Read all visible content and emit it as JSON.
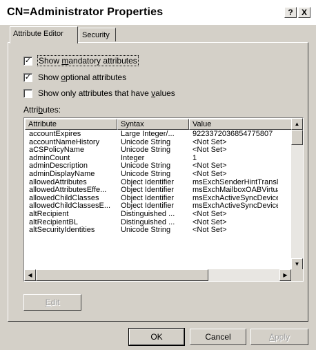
{
  "window": {
    "title": "CN=Administrator Properties",
    "help_glyph": "?",
    "close_glyph": "X"
  },
  "tabs": [
    {
      "label": "Attribute Editor",
      "active": true
    },
    {
      "label": "Security",
      "active": false
    }
  ],
  "checkboxes": [
    {
      "pre": "Show ",
      "accel": "m",
      "post": "andatory attributes",
      "checked": true,
      "check_glyph": "✓"
    },
    {
      "pre": "Show ",
      "accel": "o",
      "post": "ptional attributes",
      "checked": true,
      "check_glyph": "✓"
    },
    {
      "pre": "Show only attributes that have ",
      "accel": "v",
      "post": "alues",
      "checked": false,
      "check_glyph": ""
    }
  ],
  "attributes_label": {
    "pre": "Attri",
    "accel": "b",
    "post": "utes:"
  },
  "table": {
    "columns": [
      "Attribute",
      "Syntax",
      "Value"
    ],
    "rows": [
      [
        "accountExpires",
        "Large Integer/...",
        "9223372036854775807"
      ],
      [
        "accountNameHistory",
        "Unicode String",
        "<Not Set>"
      ],
      [
        "aCSPolicyName",
        "Unicode String",
        "<Not Set>"
      ],
      [
        "adminCount",
        "Integer",
        "1"
      ],
      [
        "adminDescription",
        "Unicode String",
        "<Not Set>"
      ],
      [
        "adminDisplayName",
        "Unicode String",
        "<Not Set>"
      ],
      [
        "allowedAttributes",
        "Object Identifier",
        "msExchSenderHintTransl"
      ],
      [
        "allowedAttributesEffe...",
        "Object Identifier",
        "msExchMailboxOABVirtua"
      ],
      [
        "allowedChildClasses",
        "Object Identifier",
        "msExchActiveSyncDevice"
      ],
      [
        "allowedChildClassesE...",
        "Object Identifier",
        "msExchActiveSyncDevice"
      ],
      [
        "altRecipient",
        "Distinguished ...",
        "<Not Set>"
      ],
      [
        "altRecipientBL",
        "Distinguished ...",
        "<Not Set>"
      ],
      [
        "altSecurityIdentities",
        "Unicode String",
        "<Not Set>"
      ]
    ]
  },
  "scroll_glyphs": {
    "up": "▲",
    "down": "▼",
    "left": "◀",
    "right": "▶"
  },
  "buttons": {
    "edit": {
      "accel": "E",
      "rest": "dit"
    },
    "ok": "OK",
    "cancel": "Cancel",
    "apply": {
      "accel": "A",
      "rest": "pply"
    }
  }
}
